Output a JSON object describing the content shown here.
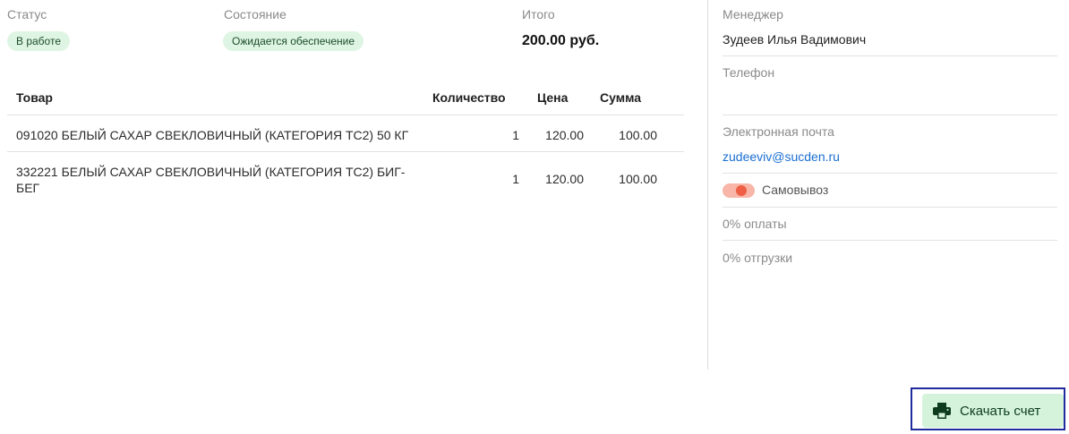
{
  "summary": {
    "status_label": "Статус",
    "status_value": "В работе",
    "state_label": "Состояние",
    "state_value": "Ожидается обеспечение",
    "total_label": "Итого",
    "total_value": "200.00 руб."
  },
  "table": {
    "headers": {
      "product": "Товар",
      "quantity": "Количество",
      "price": "Цена",
      "sum": "Сумма"
    },
    "rows": [
      {
        "product": "091020 БЕЛЫЙ САХАР СВЕКЛОВИЧНЫЙ (КАТЕГОРИЯ ТС2) 50 КГ",
        "quantity": "1",
        "price": "120.00",
        "sum": "100.00"
      },
      {
        "product_line1": "332221 БЕЛЫЙ САХАР СВЕКЛОВИЧНЫЙ (КАТЕГОРИЯ ТС2) БИГ-",
        "product_line2": "БЕГ",
        "quantity": "1",
        "price": "120.00",
        "sum": "100.00"
      }
    ]
  },
  "sidebar": {
    "manager_label": "Менеджер",
    "manager_value": "Зудеев Илья Вадимович",
    "phone_label": "Телефон",
    "phone_value": "",
    "email_label": "Электронная почта",
    "email_value": "zudeeviv@sucden.ru",
    "pickup_label": "Самовывоз",
    "payment_text": "0% оплаты",
    "shipment_text": "0% отгрузки"
  },
  "actions": {
    "download_label": "Скачать счет",
    "download_icon": "printer-icon",
    "accent_color": "#d4f3da"
  }
}
